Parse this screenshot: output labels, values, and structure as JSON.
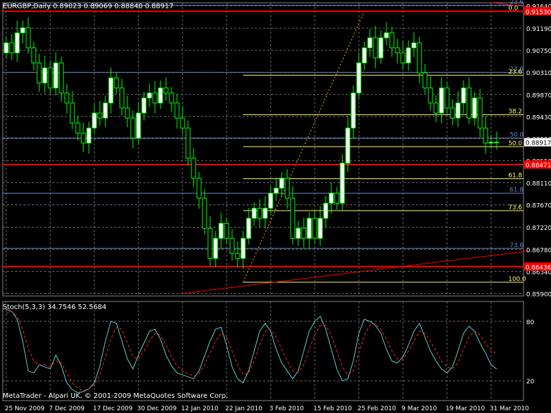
{
  "chart_data": [
    {
      "type": "candlestick",
      "header_text": "EURGBP,Daily  0.89023 0.89069 0.88840 0.88917",
      "symbol": "EURGBP",
      "timeframe": "Daily",
      "ohlc_header": {
        "open": 0.89023,
        "high": 0.89069,
        "low": 0.8884,
        "close": 0.88917
      },
      "current_price_label": "0.88917",
      "ylim": [
        0.8585,
        0.917
      ],
      "y_tick_labels": [
        "0.91640",
        "0.91190",
        "0.90750",
        "0.90310",
        "0.89870",
        "0.89430",
        "0.88990",
        "0.88550",
        "0.88110",
        "0.87670",
        "0.87220",
        "0.86780",
        "0.86340",
        "0.85900"
      ],
      "y_ticks": [
        0.9164,
        0.9119,
        0.9075,
        0.9031,
        0.8987,
        0.8943,
        0.8899,
        0.8855,
        0.8811,
        0.8767,
        0.8722,
        0.8678,
        0.8634,
        0.859
      ],
      "x_tick_labels": [
        "25 Nov 2009",
        "7 Dec 2009",
        "17 Dec 2009",
        "30 Dec 2009",
        "12 Jan 2010",
        "22 Jan 2010",
        "3 Feb 2010",
        "15 Feb 2010",
        "25 Feb 2010",
        "9 Mar 2010",
        "19 Mar 2010",
        "31 Mar 2010"
      ],
      "x_tick_bars": [
        0,
        8,
        16,
        24,
        32,
        40,
        48,
        56,
        64,
        72,
        80,
        88
      ],
      "bar_count": 90,
      "grid": true,
      "colors": {
        "background": "#000000",
        "bull": "#ffffff",
        "bear": "#000000",
        "wick": "#00ff00",
        "grid": "#6e6e6e",
        "axis_text": "#ffffff",
        "level_red": "#ff0000",
        "fibo_yellow": "#ffff66",
        "fibo_blue": "#6688cc",
        "price_tag": "#ff0000"
      },
      "candles_close": [
        0.909,
        0.907,
        0.911,
        0.912,
        0.908,
        0.905,
        0.901,
        0.904,
        0.9,
        0.905,
        0.899,
        0.897,
        0.893,
        0.891,
        0.889,
        0.892,
        0.895,
        0.894,
        0.897,
        0.902,
        0.9,
        0.896,
        0.894,
        0.89,
        0.895,
        0.898,
        0.899,
        0.897,
        0.9,
        0.899,
        0.897,
        0.894,
        0.892,
        0.886,
        0.882,
        0.878,
        0.872,
        0.866,
        0.87,
        0.873,
        0.87,
        0.867,
        0.866,
        0.87,
        0.874,
        0.876,
        0.874,
        0.876,
        0.879,
        0.88,
        0.882,
        0.878,
        0.87,
        0.872,
        0.87,
        0.874,
        0.87,
        0.874,
        0.877,
        0.879,
        0.877,
        0.885,
        0.892,
        0.899,
        0.905,
        0.908,
        0.91,
        0.906,
        0.91,
        0.911,
        0.908,
        0.907,
        0.905,
        0.908,
        0.909,
        0.903,
        0.9,
        0.897,
        0.895,
        0.9,
        0.896,
        0.894,
        0.897,
        0.9,
        0.894,
        0.898,
        0.892,
        0.889,
        0.8892,
        0.8892
      ],
      "horizontal_levels": [
        {
          "price": 0.9153,
          "label": "0.91530",
          "color": "#ff0000",
          "width": 2
        },
        {
          "price": 0.88471,
          "label": "0.88471",
          "color": "#ff0000",
          "width": 2
        },
        {
          "price": 0.86436,
          "label": "0.86436",
          "color": "#ff0000",
          "width": 2
        }
      ],
      "fibo_primary": {
        "color": "#ffff66",
        "levels": [
          {
            "label": "0.0",
            "price": 0.9153
          },
          {
            "label": "23.6",
            "price": 0.90255
          },
          {
            "label": "38.2",
            "price": 0.89466
          },
          {
            "label": "50.0",
            "price": 0.8883
          },
          {
            "label": "61.8",
            "price": 0.8819
          },
          {
            "label": "73.6",
            "price": 0.87553
          },
          {
            "label": "100.0",
            "price": 0.86125
          }
        ]
      },
      "fibo_secondary": {
        "color": "#6688cc",
        "levels": [
          {
            "label": "23.6",
            "price": 0.9165
          },
          {
            "label": "23.6",
            "price": 0.9031
          },
          {
            "label": "50.0",
            "price": 0.89
          },
          {
            "label": "61.8",
            "price": 0.879
          },
          {
            "label": "73.6",
            "price": 0.868
          }
        ]
      },
      "trendline_red": {
        "from": {
          "bar": 32,
          "price": 0.859
        },
        "to": {
          "bar": 95,
          "price": 0.8675
        }
      },
      "trendline_red_top": {
        "from": {
          "bar": 88,
          "price": 0.917
        },
        "to": {
          "bar": 95,
          "price": 0.9162
        }
      },
      "fibo_dotted": {
        "from": {
          "bar": 43,
          "price": 0.86125
        },
        "to": {
          "bar": 65,
          "price": 0.9153
        }
      }
    },
    {
      "type": "line",
      "header_text": "Stoch(5,3,3) 34.7546 52.5684",
      "indicator": "Stoch(5,3,3)",
      "values_header": [
        34.7546,
        52.5684
      ],
      "ylim": [
        0,
        100
      ],
      "y_tick_labels": [
        "80",
        "20"
      ],
      "y_ticks": [
        80,
        20
      ],
      "level_lines": [
        80,
        20
      ],
      "series": [
        {
          "color": "#66cccc",
          "style": "solid",
          "values": [
            92,
            90,
            82,
            60,
            30,
            28,
            36,
            34,
            32,
            46,
            35,
            18,
            11,
            8,
            9,
            12,
            18,
            35,
            60,
            80,
            78,
            60,
            42,
            32,
            46,
            58,
            70,
            72,
            62,
            46,
            35,
            28,
            26,
            24,
            22,
            30,
            45,
            60,
            72,
            74,
            56,
            34,
            22,
            18,
            30,
            50,
            70,
            78,
            70,
            52,
            38,
            30,
            22,
            30,
            50,
            70,
            80,
            85,
            72,
            52,
            32,
            20,
            22,
            40,
            68,
            82,
            80,
            76,
            68,
            52,
            40,
            38,
            44,
            56,
            70,
            78,
            64,
            50,
            40,
            32,
            28,
            34,
            50,
            68,
            75,
            70,
            58,
            48,
            36,
            32
          ]
        },
        {
          "color": "#ff2222",
          "style": "dashed",
          "values": [
            88,
            90,
            85,
            72,
            52,
            40,
            36,
            36,
            34,
            40,
            38,
            28,
            18,
            12,
            10,
            12,
            16,
            26,
            44,
            62,
            74,
            72,
            58,
            44,
            42,
            50,
            60,
            68,
            66,
            56,
            44,
            35,
            30,
            27,
            25,
            27,
            36,
            48,
            60,
            68,
            64,
            50,
            36,
            26,
            28,
            40,
            56,
            70,
            72,
            64,
            52,
            40,
            30,
            28,
            36,
            52,
            66,
            76,
            76,
            66,
            50,
            34,
            26,
            30,
            48,
            66,
            76,
            78,
            72,
            62,
            50,
            42,
            42,
            50,
            60,
            70,
            68,
            60,
            50,
            40,
            34,
            32,
            38,
            52,
            64,
            70,
            66,
            58,
            50,
            48
          ]
        }
      ]
    }
  ],
  "footer": {
    "copyright": "MetaTrader - Alpari UK, © 2001-2009 MetaQuotes Software Corp."
  }
}
